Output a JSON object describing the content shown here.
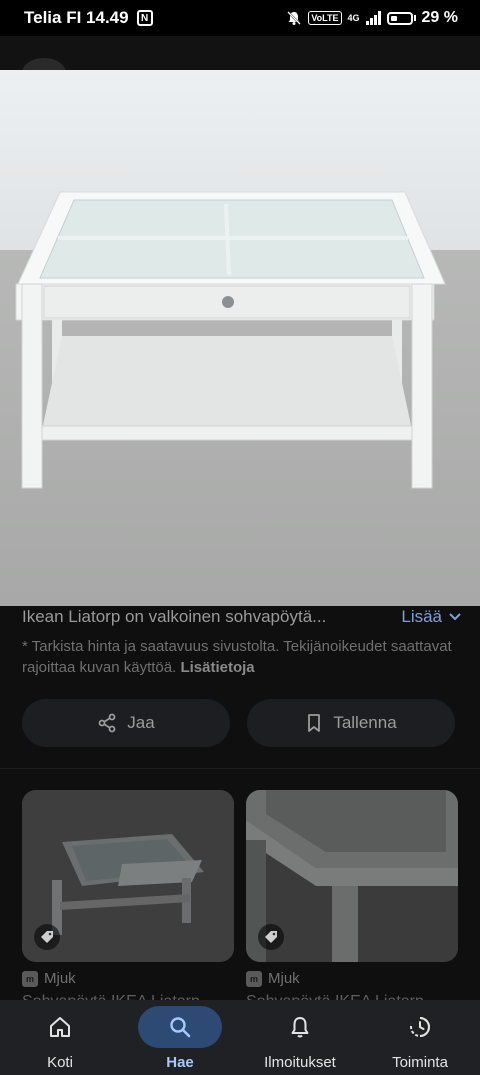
{
  "status_bar": {
    "carrier_time": "Telia FI 14.49",
    "nfc_icon": "nfc-icon",
    "volte": "VoLTE",
    "network": "4G",
    "battery": "29 %"
  },
  "caption": {
    "title": "Ikean Liatorp on valkoinen sohvapöytä...",
    "more_label": "Lisää"
  },
  "notice": {
    "text": "* Tarkista hinta ja saatavuus sivustolta. Tekijänoikeudet saattavat rajoittaa kuvan käyttöä.",
    "link": "Lisätietoja"
  },
  "actions": {
    "share_label": "Jaa",
    "save_label": "Tallenna"
  },
  "related": [
    {
      "source": "Mjuk",
      "title": "Sohvapöytä IKEA Liatorp"
    },
    {
      "source": "Mjuk",
      "title": "Sohvapöytä IKEA Liatorp"
    }
  ],
  "nav": {
    "items": [
      {
        "label": "Koti",
        "icon": "home-icon",
        "active": false
      },
      {
        "label": "Hae",
        "icon": "search-icon",
        "active": true
      },
      {
        "label": "Ilmoitukset",
        "icon": "bell-icon",
        "active": false
      },
      {
        "label": "Toiminta",
        "icon": "history-icon",
        "active": false
      }
    ]
  },
  "colors": {
    "accent": "#a8c7fa",
    "active_pill": "#2c4a74",
    "background": "#0f0f10",
    "nav_background": "#1f2125"
  }
}
